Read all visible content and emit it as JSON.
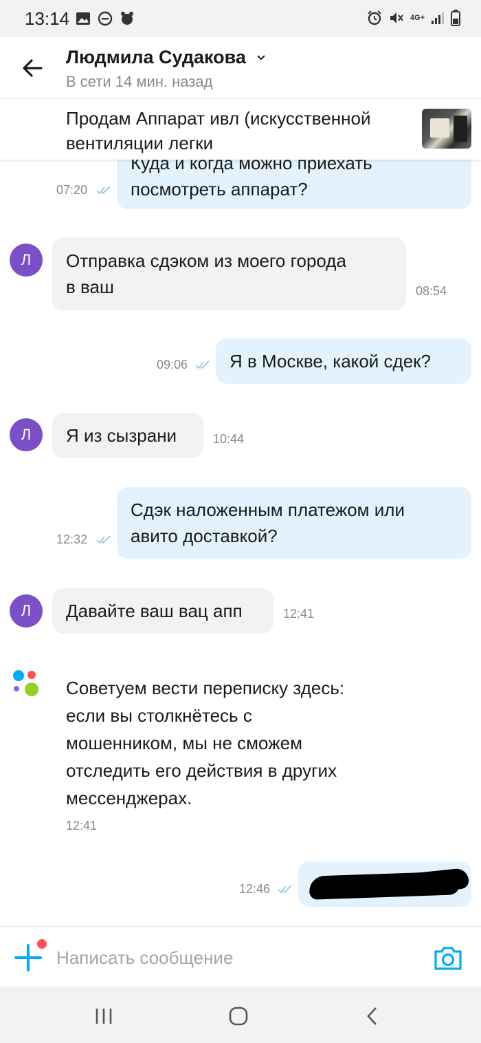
{
  "status_bar": {
    "time": "13:14",
    "network": "4G+"
  },
  "header": {
    "contact_name": "Людмила Судакова",
    "status": "В сети 14 мин. назад"
  },
  "listing": {
    "title": "Продам Аппарат ивл (искусственной вентиляции легки"
  },
  "messages": [
    {
      "direction": "out",
      "text": "Куда и когда можно приехать\nпосмотреть аппарат?",
      "time": "07:20",
      "read": true
    },
    {
      "direction": "in",
      "avatar": "Л",
      "text": "Отправка сдэком из моего города\nв ваш",
      "time": "08:54"
    },
    {
      "direction": "out",
      "text": "Я в Москве, какой сдек?",
      "time": "09:06",
      "read": true
    },
    {
      "direction": "in",
      "avatar": "Л",
      "text": "Я из сызрани",
      "time": "10:44"
    },
    {
      "direction": "out",
      "text": "Сдэк наложенным платежом или\nавито доставкой?",
      "time": "12:32",
      "read": true
    },
    {
      "direction": "in",
      "avatar": "Л",
      "text": "Давайте ваш вац апп",
      "time": "12:41"
    },
    {
      "direction": "system",
      "text": "Советуем вести переписку здесь:\nесли вы столкнётесь с\nмошенником, мы не сможем\nотследить его действия в других\nмессенджерах.",
      "time": "12:41"
    },
    {
      "direction": "out",
      "text": "",
      "time": "12:46",
      "read": true,
      "redacted": true
    }
  ],
  "input": {
    "placeholder": "Написать сообщение"
  },
  "colors": {
    "accent": "#00aaff",
    "outgoing_bubble": "#e3f2fc",
    "incoming_bubble": "#f2f2f2",
    "avatar": "#7a4fc8",
    "notification_dot": "#ff4f5a"
  }
}
